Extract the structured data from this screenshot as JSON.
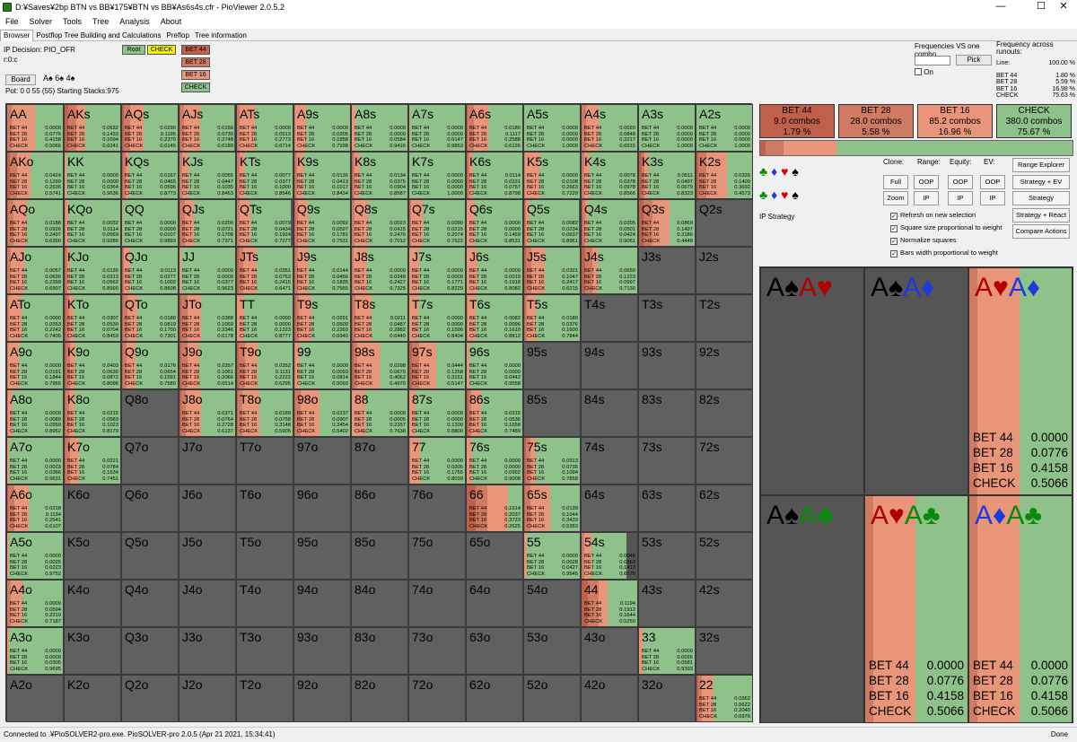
{
  "window": {
    "title": "D:¥Saves¥2bp BTN vs BB¥175¥BTN vs BB¥As6s4s.cfr - PioViewer 2.0.5.2",
    "minimize": "—",
    "maximize": "☐",
    "close": "✕"
  },
  "menu": [
    "File",
    "Solver",
    "Tools",
    "Tree",
    "Analysis",
    "About"
  ],
  "tabs": [
    "Browser",
    "Postflop Tree Building and Calculations",
    "Preflop",
    "Tree information"
  ],
  "info": {
    "decision": "IP Decision:  PIO_OFR",
    "node": "r:0:c",
    "board_button": "Board",
    "board_cards": "A♠  6♠  4♠",
    "pot": "Pot: 0 0 55 (55) Starting Stacks:975"
  },
  "path": {
    "root": "Root",
    "check": "CHECK",
    "actions": [
      "BET 44",
      "BET 28",
      "BET 16",
      "CHECK"
    ]
  },
  "freq_box": {
    "label": "Frequencies VS one combo",
    "pick": "Pick",
    "on": "On"
  },
  "runouts": {
    "header": "Frequency across runouts:",
    "line_label": "Line:",
    "line_value": "100.00 %",
    "rows": [
      {
        "k": "BET 44",
        "v": "1.80 %"
      },
      {
        "k": "BET 28",
        "v": "5.59 %"
      },
      {
        "k": "BET 16",
        "v": "16.98 %"
      },
      {
        "k": "CHECK",
        "v": "75.63 %"
      }
    ]
  },
  "colors": {
    "bet44": "#c0604a",
    "bet28": "#cf7a62",
    "bet16": "#e8957a",
    "check": "#8fc18a",
    "empty": "#606060",
    "cell_border": "#3a3a3a"
  },
  "summary": [
    {
      "label": "BET 44",
      "combos": "9.0 combos",
      "pct": "1.79 %",
      "freq": 0.0179
    },
    {
      "label": "BET 28",
      "combos": "28.0 combos",
      "pct": "5.58 %",
      "freq": 0.0558
    },
    {
      "label": "BET 16",
      "combos": "85.2 combos",
      "pct": "16.96 %",
      "freq": 0.1696
    },
    {
      "label": "CHECK",
      "combos": "380.0 combos",
      "pct": "75.67 %",
      "freq": 0.7567
    }
  ],
  "controls": {
    "suit_rows": [
      "♣♦♥♠",
      "♣♦♥♠"
    ],
    "ip_label": "IP Strategy",
    "clone": "Clone:",
    "range": "Range:",
    "equity": "Equity:",
    "ev": "EV:",
    "full": "Full",
    "zoom": "Zoom",
    "oop": "OOP",
    "ip": "IP",
    "range_explorer": "Range Explorer",
    "strategy_ev": "Strategy + EV",
    "strategy": "Strategy",
    "strategy_react": "Strategy + React",
    "compare": "Compare Actions",
    "checks": [
      "Refresh on new selection",
      "Square size proportional to weight",
      "Normalize squares",
      "Bars width proportional to weight"
    ]
  },
  "action_labels": [
    "BET 44",
    "BET 28",
    "BET 16",
    "CHECK"
  ],
  "grid": [
    [
      "AA:0.0000,0.0776,0.4158,0.5066",
      "AKs:0.0632,0.1433,0.1694,0.6241",
      "AQs:0.0290,0.1195,0.2370,0.6145",
      "AJs:0.0156,0.0730,0.2748,0.6189",
      "ATs:0.0000,0.0513,0.2773,0.6714",
      "A9s:0.0000,0.0205,0.1858,0.7938",
      "A8s:0.0000,0.0000,0.0584,0.9416",
      "A7s:0.0000,0.0000,0.0147,0.9853",
      "A6s:0.0180,0.1117,0.2588,0.6135",
      "A5s:0.0000,0.0000,0.0000,1.0000",
      "A4s:0.0020,0.0848,0.2217,0.6915",
      "A3s:0.0000,0.0000,0.0000,1.0000",
      "A2s:0.0000,0.0000,0.0000,1.0000"
    ],
    [
      "AKo:0.0424,0.1299,0.2536,0.5741",
      "KK:0.0000,0.0000,0.0364,0.9636",
      "KQs:0.0167,0.0465,0.0596,0.8773",
      "KJs:0.0055,0.0447,0.1035,0.8463",
      "KTs:0.0077,0.0377,0.1000,0.8546",
      "K9s:0.0136,0.0413,0.1017,0.8434",
      "K8s:0.0134,0.0375,0.0904,0.8587",
      "K7s:0.0000,0.0000,0.0000,1.0000",
      "K6s:0.0114,0.0331,0.0757,0.8798",
      "K5s:0.0000,0.0108,0.2663,0.7229",
      "K4s:0.0078,0.0378,0.0978,0.8566",
      "K3s:0.0511,0.0497,0.0679,0.8323",
      "K2s:0.0326,0.1409,0.3692,0.4573"
    ],
    [
      "AQo:0.0188,0.0926,0.2497,0.6390",
      "KQo:0.0032,0.0114,0.0569,0.9285",
      "QQ:0.0000,0.0000,0.0107,0.9893",
      "QJs:0.0200,0.0721,0.1708,0.7371",
      "QTs:0.0079,0.0434,0.1924,0.7277",
      "Q9s:0.0092,0.0597,0.1781,0.7531",
      "Q8s:0.0023,0.0415,0.2476,0.7012",
      "Q7s:0.0090,0.0215,0.2074,0.7622",
      "Q6s:0.0000,0.0000,0.1469,0.8531",
      "Q5s:0.0082,0.0234,0.0637,0.8961",
      "Q4s:0.0205,0.0501,0.0424,0.9051",
      "Q3s:0.0869,0.1497,0.3186,0.4448",
      "Q2s"
    ],
    [
      "AJo:0.0057,0.0636,0.2399,0.6907",
      "KJo:0.0136,0.0313,0.0562,0.8990",
      "QJo:0.0113,0.0277,0.1002,0.8608",
      "JJ:0.0000,0.0000,0.0377,0.9623",
      "JTs:0.0351,0.0763,0.2415,0.6471",
      "J9s:0.0144,0.0456,0.1835,0.7565",
      "J8s:0.0000,0.0248,0.2427,0.7325",
      "J7s:0.0000,0.0000,0.1771,0.8229",
      "J6s:0.0000,0.0019,0.1918,0.8082",
      "J5s:0.0321,0.1047,0.2417,0.6215",
      "J4s:0.0650,0.1223,0.0997,0.7130",
      "J3s",
      "J2s"
    ],
    [
      "ATo:0.0000,0.0353,0.2242,0.7405",
      "KTo:0.0307,0.0530,0.0704,0.8459",
      "QTo:0.0180,0.0819,0.1700,0.7301",
      "JTo:0.0388,0.1069,0.2346,0.6178",
      "TT:0.0000,0.0000,0.1223,0.8777",
      "T9s:0.0291,0.0500,0.2269,0.6940",
      "T8s:0.0211,0.0487,0.2882,0.6440",
      "T7s:0.0000,0.0000,0.1596,0.8404",
      "T6s:0.0082,0.0096,0.1610,0.8812",
      "T5s:0.0180,0.0376,0.1600,0.7844",
      "T4s",
      "T3s",
      "T2s"
    ],
    [
      "A9o:0.0000,0.0191,0.1844,0.7965",
      "K9o:0.0403,0.0630,0.0872,0.8096",
      "Q9o:0.0176,0.0654,0.1591,0.7580",
      "J9o:0.0357,0.1061,0.2066,0.6514",
      "T9o:0.0352,0.1131,0.2222,0.6295",
      "99:0.0000,0.0093,0.0814,0.9093",
      "98s:0.0298,0.0670,0.4062,0.4970",
      "97s:0.0444,0.1258,0.3151,0.5147",
      "96s:0.0000,0.0000,0.0442,0.9558",
      "95s",
      "94s",
      "93s",
      "92s"
    ],
    [
      "A8o:0.0000,0.0089,0.0959,0.8952",
      "K8o:0.0215,0.0583,0.1023,0.8179",
      "Q8o",
      "J8o:0.0371,0.0764,0.2728,0.6137",
      "T8o:0.0189,0.0758,0.3148,0.5905",
      "98o:0.0237,0.0907,0.3454,0.5402",
      "88:0.0000,0.0005,0.2357,0.7638",
      "87s:0.0000,0.0000,0.1200,0.8800",
      "86s:0.0315,0.0536,0.1658,0.7489",
      "85s",
      "84s",
      "83s",
      "82s"
    ],
    [
      "A7o:0.0000,0.0023,0.0366,0.9631",
      "K7o:0.0221,0.0784,0.1534,0.7451",
      "Q7o",
      "J7o",
      "T7o",
      "97o",
      "87o",
      "77:0.0000,0.0205,0.1756,0.8039",
      "76s:0.0000,0.0000,0.0992,0.9008",
      "75s:0.0313,0.0736,0.1094,0.7858",
      "74s",
      "73s",
      "72s"
    ],
    [
      "A6o:0.0218,0.1134,0.2541,0.6107",
      "K6o",
      "Q6o",
      "J6o",
      "T6o",
      "96o",
      "86o",
      "76o",
      "66:0.1614,0.2037,0.3723,0.2625",
      "65s:0.0139,0.1044,0.3433,0.5383",
      "64s",
      "63s",
      "62s"
    ],
    [
      "A5o:0.0000,0.0025,0.0223,0.9752",
      "K5o",
      "Q5o",
      "J5o",
      "T5o",
      "95o",
      "85o",
      "75o",
      "65o",
      "55:0.0000,0.0028,0.0427,0.9545",
      "54s:0.0048,0.0363,0.1413,0.6175",
      "53s",
      "52s"
    ],
    [
      "A4o:0.0009,0.0594,0.2210,0.7187",
      "K4o",
      "Q4o",
      "J4o",
      "T4o",
      "94o",
      "84o",
      "74o",
      "64o",
      "54o",
      "44:0.1194,0.1912,0.1644,0.5250",
      "43s",
      "42s"
    ],
    [
      "A3o:0.0000,0.0000,0.0305,0.9695",
      "K3o",
      "Q3o",
      "J3o",
      "T3o",
      "93o",
      "83o",
      "73o",
      "63o",
      "53o",
      "43o",
      "33:0.0000,0.0026,0.0581,0.9393",
      "32s"
    ],
    [
      "A2o",
      "K2o",
      "Q2o",
      "J2o",
      "T2o",
      "92o",
      "82o",
      "72o",
      "62o",
      "52o",
      "42o",
      "32o",
      "22:0.0362,0.0622,0.2040,0.6976"
    ]
  ],
  "combos": [
    {
      "cards": [
        {
          "r": "A",
          "s": "♠",
          "c": "#000"
        },
        {
          "r": "A",
          "s": "♥",
          "c": "#b00000"
        }
      ],
      "f": [
        "0.0000",
        "0.0000",
        "0.0000",
        "0.0000"
      ],
      "fr": [
        0,
        0,
        0,
        0
      ],
      "show": false
    },
    {
      "cards": [
        {
          "r": "A",
          "s": "♠",
          "c": "#000"
        },
        {
          "r": "A",
          "s": "♦",
          "c": "#1a3cdc"
        }
      ],
      "f": [
        "0.0000",
        "0.0000",
        "0.0000",
        "0.0000"
      ],
      "fr": [
        0,
        0,
        0,
        0
      ],
      "show": false
    },
    {
      "cards": [
        {
          "r": "A",
          "s": "♥",
          "c": "#b00000"
        },
        {
          "r": "A",
          "s": "♦",
          "c": "#1a3cdc"
        }
      ],
      "f": [
        "0.0000",
        "0.0776",
        "0.4158",
        "0.5066"
      ],
      "fr": [
        0,
        0.0776,
        0.4158,
        0.5066
      ],
      "show": true
    },
    {
      "cards": [
        {
          "r": "A",
          "s": "♠",
          "c": "#000"
        },
        {
          "r": "A",
          "s": "♣",
          "c": "#0a8a0a"
        }
      ],
      "f": [
        "0.0000",
        "0.0000",
        "0.0000",
        "0.0000"
      ],
      "fr": [
        0,
        0,
        0,
        0
      ],
      "show": false
    },
    {
      "cards": [
        {
          "r": "A",
          "s": "♥",
          "c": "#b00000"
        },
        {
          "r": "A",
          "s": "♣",
          "c": "#0a8a0a"
        }
      ],
      "f": [
        "0.0000",
        "0.0776",
        "0.4158",
        "0.5066"
      ],
      "fr": [
        0,
        0.0776,
        0.4158,
        0.5066
      ],
      "show": true
    },
    {
      "cards": [
        {
          "r": "A",
          "s": "♦",
          "c": "#1a3cdc"
        },
        {
          "r": "A",
          "s": "♣",
          "c": "#0a8a0a"
        }
      ],
      "f": [
        "0.0000",
        "0.0776",
        "0.4158",
        "0.5066"
      ],
      "fr": [
        0,
        0.0776,
        0.4158,
        0.5066
      ],
      "show": true
    }
  ],
  "status": {
    "left": "Connected to .¥PioSOLVER2-pro.exe. PioSOLVER-pro 2.0.5 (Apr 21 2021, 15:34:41)",
    "right": "Done"
  }
}
